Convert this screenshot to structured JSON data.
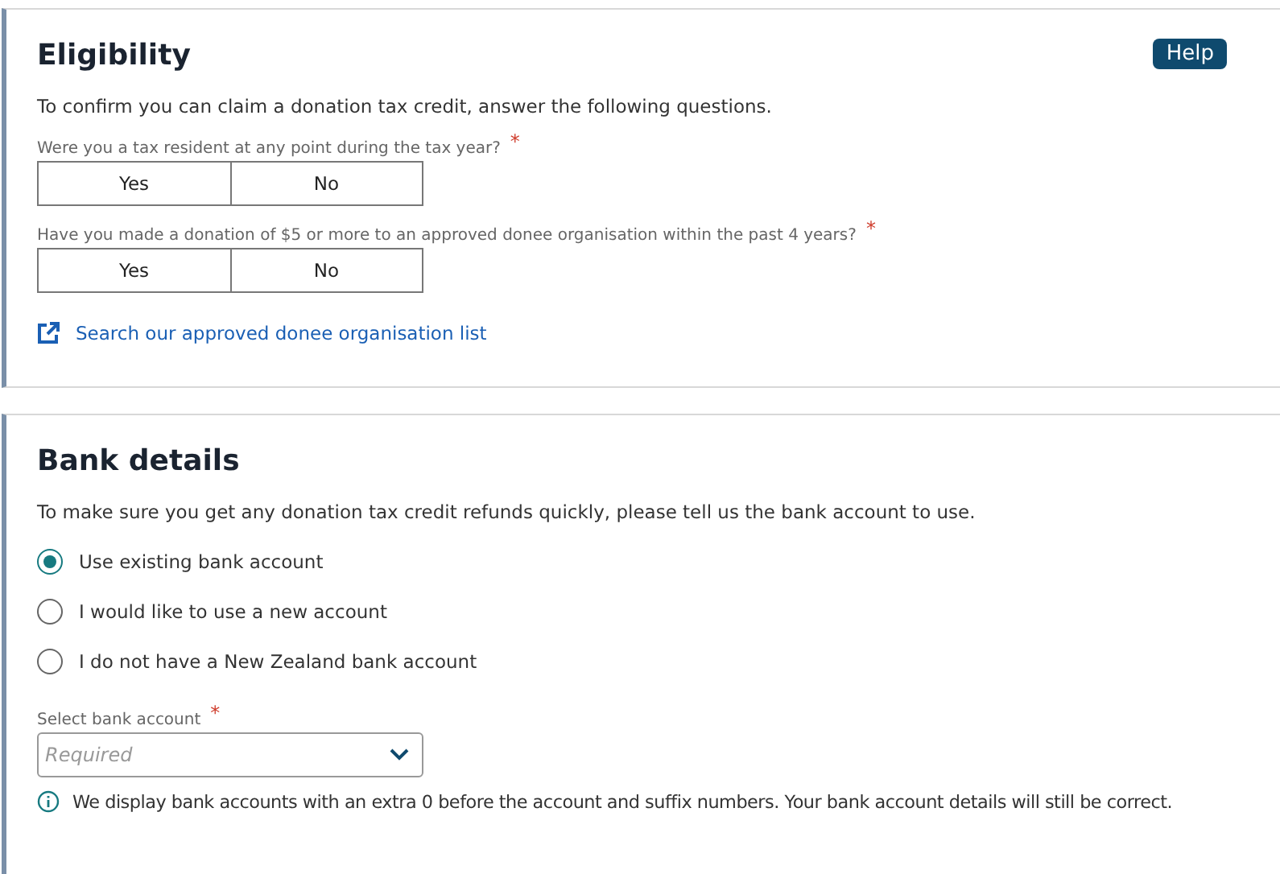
{
  "eligibility": {
    "title": "Eligibility",
    "help_button": "Help",
    "intro": "To confirm you can claim a donation tax credit, answer the following questions.",
    "questions": [
      {
        "label": "Were you a tax resident at any point during the tax year?",
        "required_mark": "*",
        "options": [
          {
            "label": "Yes",
            "selected": false
          },
          {
            "label": "No",
            "selected": false
          }
        ]
      },
      {
        "label": "Have you made a donation of $5 or more to an approved donee organisation within the past 4 years?",
        "required_mark": "*",
        "options": [
          {
            "label": "Yes",
            "selected": false
          },
          {
            "label": "No",
            "selected": false
          }
        ]
      }
    ],
    "link": "Search our approved donee organisation list"
  },
  "bank_details": {
    "title": "Bank details",
    "intro": "To make sure you get any donation tax credit refunds quickly, please tell us the bank account to use.",
    "radios": [
      {
        "label": "Use existing bank account",
        "selected": true
      },
      {
        "label": "I would like to use a new account",
        "selected": false
      },
      {
        "label": "I do not have a New Zealand bank account",
        "selected": false
      }
    ],
    "select": {
      "label": "Select bank account",
      "required_mark": "*",
      "placeholder": "Required"
    },
    "info": "We display bank accounts with an extra 0 before the account and suffix numbers. Your bank account details will still be correct."
  }
}
